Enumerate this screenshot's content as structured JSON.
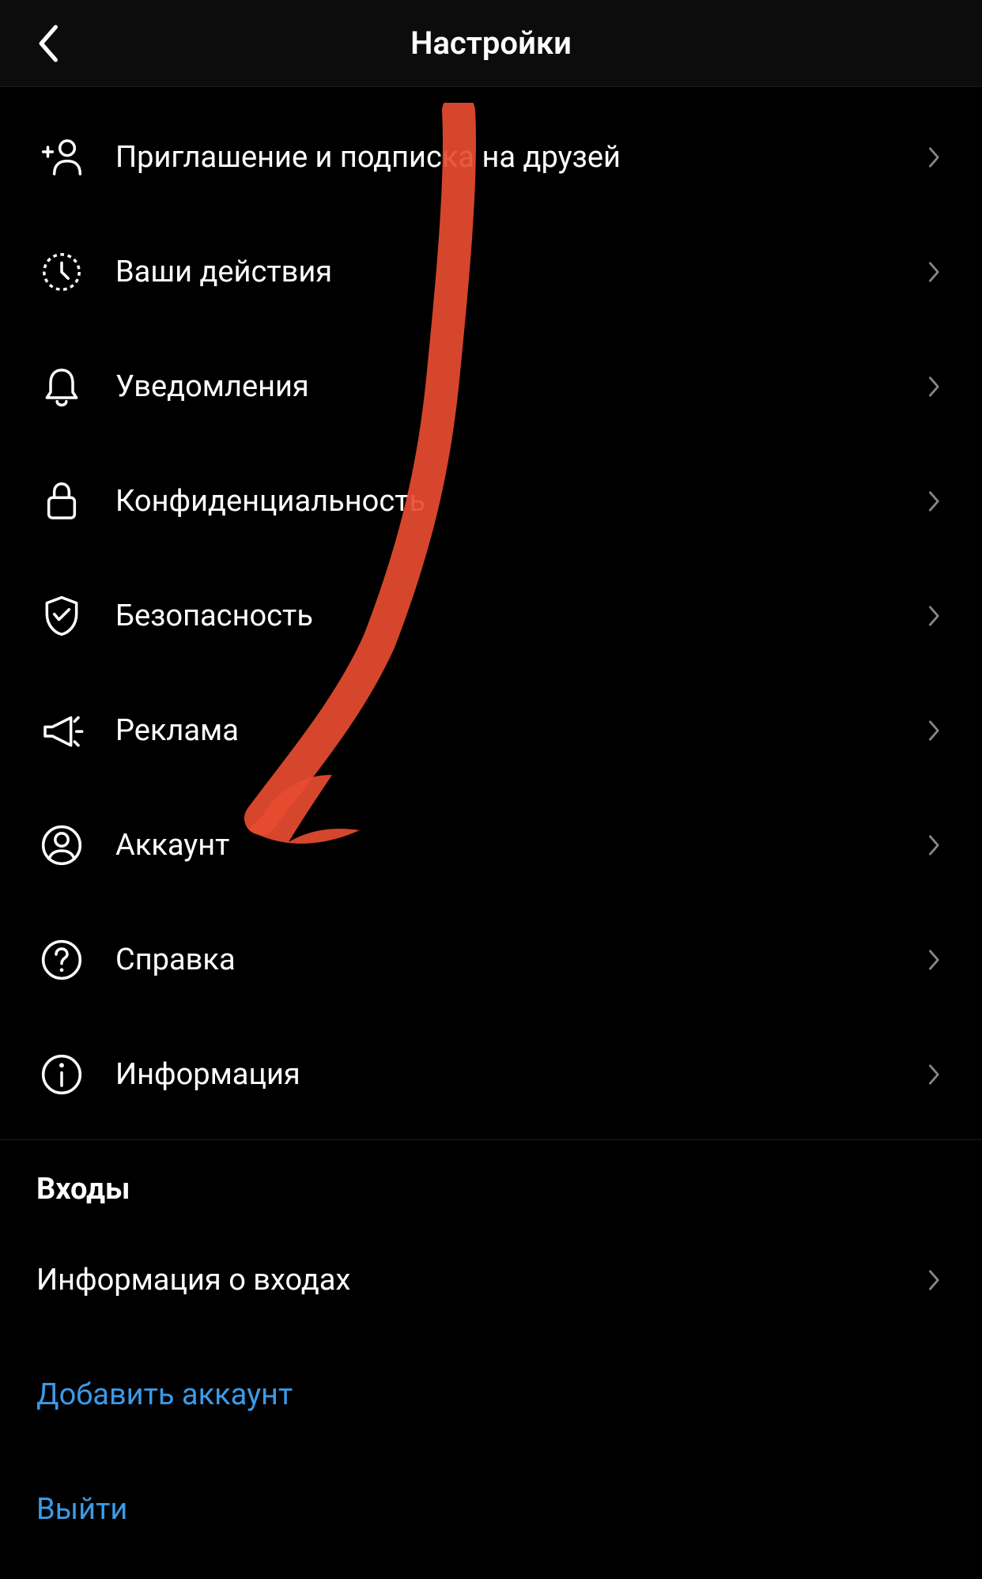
{
  "header": {
    "title": "Настройки"
  },
  "items": [
    {
      "label": "Приглашение и подписка на друзей",
      "icon": "add-person-icon"
    },
    {
      "label": "Ваши действия",
      "icon": "activity-icon"
    },
    {
      "label": "Уведомления",
      "icon": "bell-icon"
    },
    {
      "label": "Конфиденциальность",
      "icon": "lock-icon"
    },
    {
      "label": "Безопасность",
      "icon": "shield-icon"
    },
    {
      "label": "Реклама",
      "icon": "megaphone-icon"
    },
    {
      "label": "Аккаунт",
      "icon": "account-icon"
    },
    {
      "label": "Справка",
      "icon": "help-icon"
    },
    {
      "label": "Информация",
      "icon": "info-icon"
    }
  ],
  "logins": {
    "header": "Входы",
    "login_info": "Информация о входах",
    "add_account": "Добавить аккаунт",
    "logout": "Выйти"
  },
  "annotation": {
    "type": "arrow",
    "color": "#e84c30",
    "target": "Аккаунт"
  }
}
